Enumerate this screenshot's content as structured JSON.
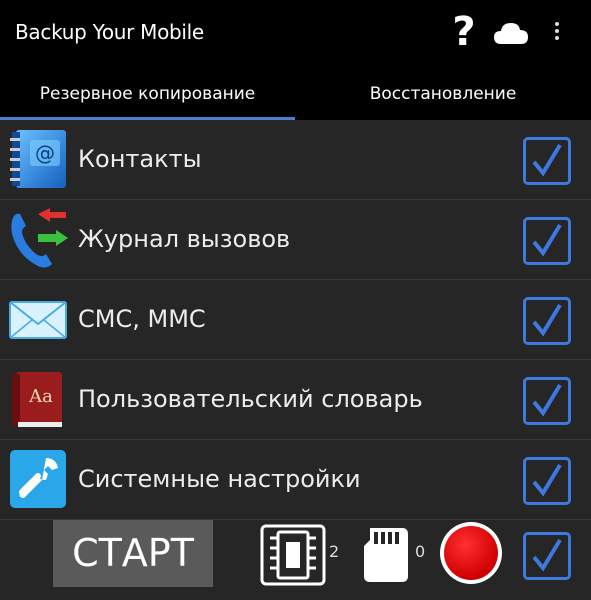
{
  "app": {
    "title": "Backup Your Mobile"
  },
  "toolbar": {
    "help_glyph": "?",
    "icons": [
      "help-icon",
      "cloud-icon",
      "overflow-menu-icon"
    ]
  },
  "tabs": [
    {
      "label": "Резервное копирование",
      "active": true
    },
    {
      "label": "Восстановление",
      "active": false
    }
  ],
  "items": [
    {
      "label": "Контакты",
      "icon": "contacts-book-icon",
      "checked": true
    },
    {
      "label": "Журнал вызовов",
      "icon": "call-log-phone-icon",
      "checked": true
    },
    {
      "label": "СМС, ММС",
      "icon": "envelope-icon",
      "checked": true
    },
    {
      "label": "Пользовательский словарь",
      "icon": "dictionary-icon",
      "checked": true
    },
    {
      "label": "Системные настройки",
      "icon": "wrench-icon",
      "checked": true
    }
  ],
  "footer": {
    "start_label": "СТАРТ",
    "internal_storage_count": "2",
    "sd_card_count": "0",
    "select_all_checked": true
  },
  "colors": {
    "accent": "#3d79e0",
    "record": "#e00000",
    "background": "#262626"
  }
}
